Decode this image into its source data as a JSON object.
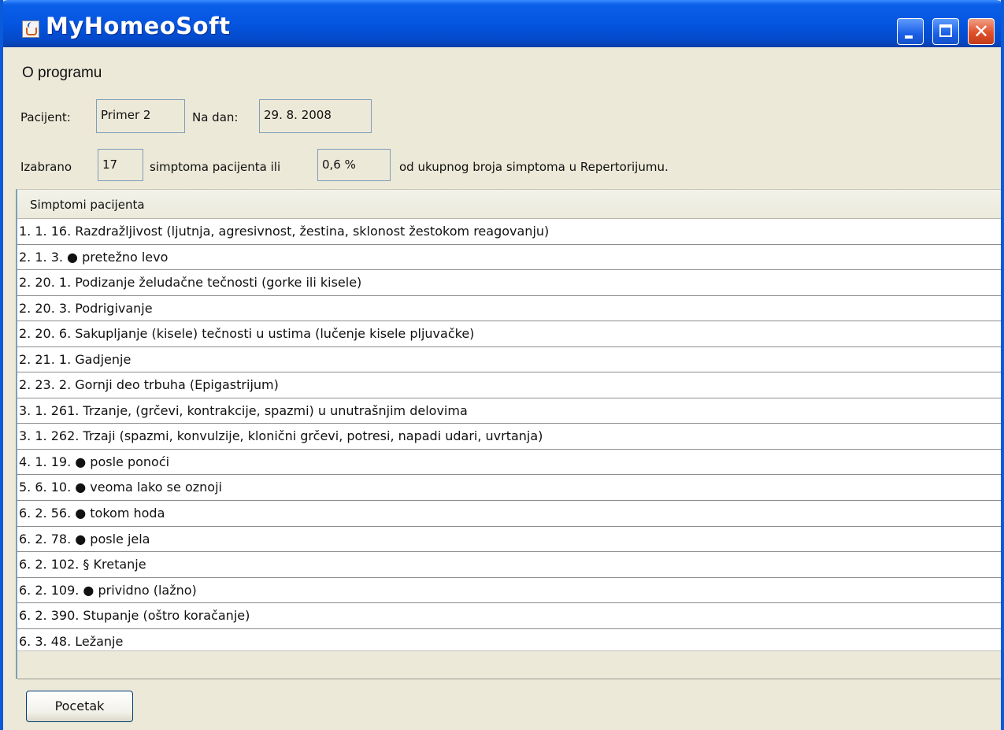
{
  "window": {
    "title": "MyHomeoSoft",
    "icon": "java-cup-icon",
    "controls": [
      "minimize",
      "maximize",
      "close"
    ],
    "close_glyph": "✕"
  },
  "menu": {
    "items": [
      "O programu"
    ]
  },
  "patient": {
    "label": "Pacijent:",
    "name": "Primer 2",
    "date_label": "Na dan:",
    "date": "29. 8. 2008"
  },
  "summary": {
    "prefix": "Izabrano",
    "count": "17",
    "middle": "simptoma pacijenta ili",
    "percent": "0,6 %",
    "suffix": "od ukupnog broja simptoma u Repertorijumu."
  },
  "table": {
    "header": "Simptomi pacijenta",
    "rows": [
      "1. 1. 16. Razdražljivost (ljutnja, agresivnost, žestina, sklonost žestokom reagovanju)",
      "2. 1. 3. ● pretežno levo",
      "2. 20. 1. Podizanje želudačne tečnosti (gorke ili kisele)",
      "2. 20. 3. Podrigivanje",
      "2. 20. 6. Sakupljanje (kisele) tečnosti u ustima (lučenje kisele pljuvačke)",
      "2. 21. 1. Gadjenje",
      "2. 23. 2. Gornji deo trbuha (Epigastrijum)",
      "3. 1. 261. Trzanje, (grčevi, kontrakcije, spazmi) u unutrašnjim delovima",
      "3. 1. 262. Trzaji (spazmi, konvulzije, klonični grčevi, potresi, napadi udari, uvrtanja)",
      "4. 1. 19. ● posle ponoći",
      "5. 6. 10. ● veoma lako se oznoji",
      "6. 2. 56. ● tokom hoda",
      "6. 2. 78. ● posle jela",
      "6. 2. 102. § Kretanje",
      "6. 2. 109. ● prividno (lažno)",
      "6. 2. 390. Stupanje (oštro koračanje)",
      "6. 3. 48. Ležanje"
    ]
  },
  "buttons": {
    "start": "Pocetak"
  }
}
